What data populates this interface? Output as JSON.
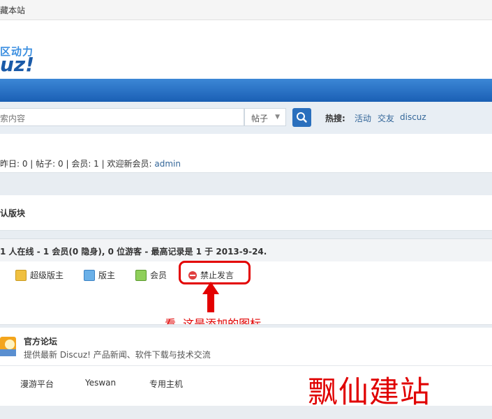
{
  "topbar": {
    "text": "藏本站"
  },
  "header": {
    "logo_cn": "区动力",
    "logo_en": "uz!"
  },
  "search": {
    "placeholder": "索内容",
    "type_label": "帖子",
    "hot_label": "热搜:",
    "hot_items": [
      "活动",
      "交友",
      "discuz"
    ]
  },
  "stats": {
    "text": "昨日: 0 | 帖子: 0 | 会员: 1 | 欢迎新会员: ",
    "new_member": "admin"
  },
  "board": {
    "title": "认版块"
  },
  "online": {
    "text": "1 人在线  - 1 会员(0 隐身), 0 位游客  - 最高记录是  1 于  2013-9-24."
  },
  "legend": {
    "items": [
      "超级版主",
      "版主",
      "会员",
      "禁止发言"
    ]
  },
  "annotation": {
    "text": "看, 这是添加的图标"
  },
  "forum": {
    "name": "官方论坛",
    "desc": "提供最新  Discuz! 产品新闻、软件下载与技术交流"
  },
  "links": [
    "漫游平台",
    "Yeswan",
    "专用主机"
  ],
  "watermark": "飘仙建站",
  "colors": {
    "nav": "#1a5fb4",
    "link": "#336699",
    "annotation": "#e30000"
  }
}
